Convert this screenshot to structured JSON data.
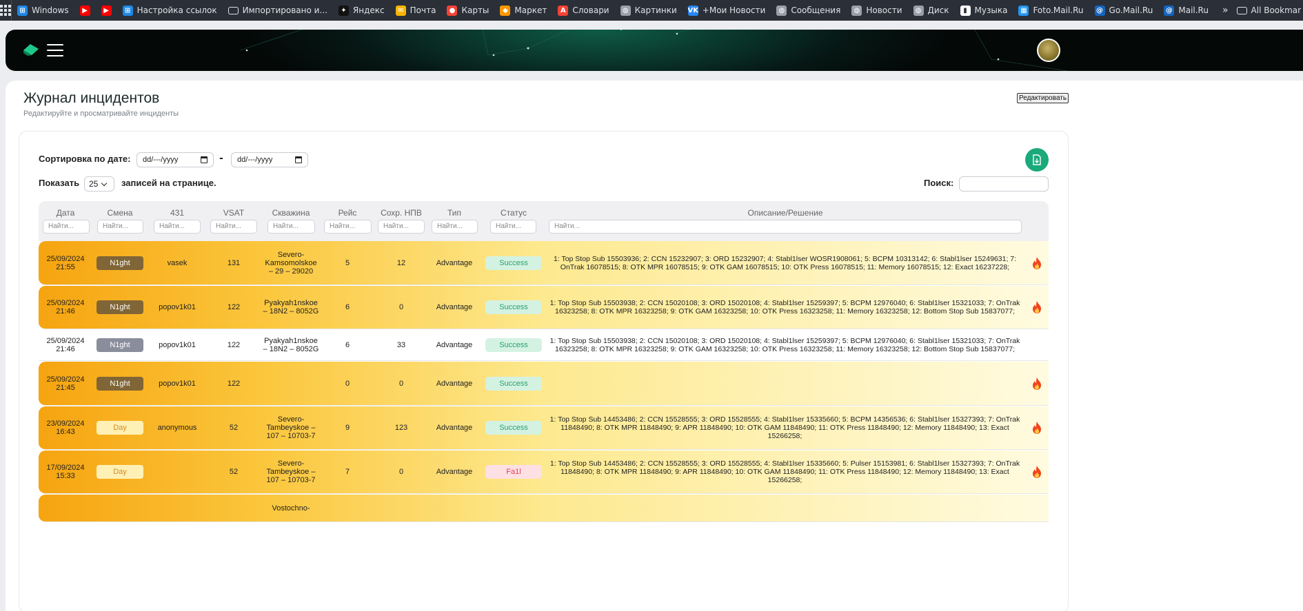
{
  "bookmarks": [
    {
      "label": "Windows",
      "icon": "windows-icon",
      "color": "#1e88e5"
    },
    {
      "label": "",
      "icon": "youtube-icon",
      "color": "#ff0000"
    },
    {
      "label": "",
      "icon": "youtube-icon",
      "color": "#ff0000"
    },
    {
      "label": "Настройка ссылок",
      "icon": "windows-icon",
      "color": "#1e88e5"
    },
    {
      "label": "Импортировано и...",
      "icon": "folder-icon",
      "color": "#2b2f38"
    },
    {
      "label": "Яндекс",
      "icon": "yandex-icon",
      "color": "#111111"
    },
    {
      "label": "Почта",
      "icon": "mail-icon",
      "color": "#f7b500"
    },
    {
      "label": "Карты",
      "icon": "map-pin-icon",
      "color": "#f44336"
    },
    {
      "label": "Маркет",
      "icon": "market-icon",
      "color": "#ff9800"
    },
    {
      "label": "Словари",
      "icon": "dictionary-icon",
      "color": "#f44336"
    },
    {
      "label": "Картинки",
      "icon": "globe-icon",
      "color": "#9aa0aa"
    },
    {
      "label": "+Мои Новости",
      "icon": "vk-icon",
      "color": "#2787f5"
    },
    {
      "label": "Сообщения",
      "icon": "globe-icon",
      "color": "#9aa0aa"
    },
    {
      "label": "Новости",
      "icon": "globe-icon",
      "color": "#9aa0aa"
    },
    {
      "label": "Диск",
      "icon": "globe-icon",
      "color": "#9aa0aa"
    },
    {
      "label": "Музыка",
      "icon": "music-icon",
      "color": "#ffffff"
    },
    {
      "label": "Foto.Mail.Ru",
      "icon": "photo-icon",
      "color": "#2196f3"
    },
    {
      "label": "Go.Mail.Ru",
      "icon": "mailru-icon",
      "color": "#1565c0"
    },
    {
      "label": "Mail.Ru",
      "icon": "mailru-icon",
      "color": "#1565c0"
    }
  ],
  "bookmarks_more": "»",
  "all_bookmarks": "All Bookmar",
  "page": {
    "title": "Журнал инцидентов",
    "subtitle": "Редактируйте и просматривайте инциденты",
    "edit_button": "Редактировать"
  },
  "controls": {
    "sort_label": "Сортировка по дате:",
    "date_from_placeholder": "dd/---/yyyy",
    "date_to_placeholder": "dd/---/yyyy",
    "date_separator": "-",
    "show_label": "Показать",
    "page_size": "25",
    "records_label": "записей на странице.",
    "search_label": "Поиск:"
  },
  "columns": [
    {
      "label": "Дата",
      "filter": "Найти..."
    },
    {
      "label": "Смена",
      "filter": "Найти..."
    },
    {
      "label": "431",
      "filter": "Найти..."
    },
    {
      "label": "VSAT",
      "filter": "Найти..."
    },
    {
      "label": "Скважина",
      "filter": "Найти..."
    },
    {
      "label": "Рейс",
      "filter": "Найти..."
    },
    {
      "label": "Сохр. НПВ",
      "filter": "Найти..."
    },
    {
      "label": "Тип",
      "filter": "Найти..."
    },
    {
      "label": "Статус",
      "filter": "Найти..."
    },
    {
      "label": "Описание/Решение",
      "filter": "Найти..."
    }
  ],
  "rows": [
    {
      "date": "25/09/2024",
      "time": "21:55",
      "shift": "N1ght",
      "shift_style": "night",
      "user": "vasek",
      "vsat": "131",
      "well": "Severo-\nKamsomolskoe\n– 29 – 29020",
      "trip": "5",
      "npv": "12",
      "type": "Advantage",
      "status": "Success",
      "status_style": "ok",
      "desc": "1: Top Stop Sub 15503936; 2: CCN 15232907; 3: ORD 15232907; 4: Stabl1lser WOSR1908061; 5: BCPM 10313142; 6: Stabl1lser 15249631; 7: OnTrak 16078515; 8: OTK MPR 16078515; 9: OTK GAM 16078515; 10: OTK Press 16078515; 11: Memory 16078515; 12: Exact 16237228;",
      "hot": true
    },
    {
      "date": "25/09/2024",
      "time": "21:46",
      "shift": "N1ght",
      "shift_style": "night",
      "user": "popov1k01",
      "vsat": "122",
      "well": "Pyakyah1nskoe\n– 18N2 – 8052G",
      "trip": "6",
      "npv": "0",
      "type": "Advantage",
      "status": "Success",
      "status_style": "ok",
      "desc": "1: Top Stop Sub 15503938; 2: CCN 15020108; 3: ORD 15020108; 4: Stabl1lser 15259397; 5: BCPM 12976040; 6: Stabl1lser 15321033; 7: OnTrak 16323258; 8: OTK MPR 16323258; 9: OTK GAM 16323258; 10: OTK Press 16323258; 11: Memory 16323258; 12: Bottom Stop Sub 15837077;",
      "hot": true
    },
    {
      "date": "25/09/2024",
      "time": "21:46",
      "shift": "N1ght",
      "shift_style": "night-grey",
      "user": "popov1k01",
      "vsat": "122",
      "well": "Pyakyah1nskoe\n– 18N2 – 8052G",
      "trip": "6",
      "npv": "33",
      "type": "Advantage",
      "status": "Success",
      "status_style": "ok",
      "desc": "1: Top Stop Sub 15503938; 2: CCN 15020108; 3: ORD 15020108; 4: Stabl1lser 15259397; 5: BCPM 12976040; 6: Stabl1lser 15321033; 7: OnTrak 16323258; 8: OTK MPR 16323258; 9: OTK GAM 16323258; 10: OTK Press 16323258; 11: Memory 16323258; 12: Bottom Stop Sub 15837077;",
      "hot": false
    },
    {
      "date": "25/09/2024",
      "time": "21:45",
      "shift": "N1ght",
      "shift_style": "night",
      "user": "popov1k01",
      "vsat": "122",
      "well": "",
      "trip": "0",
      "npv": "0",
      "type": "Advantage",
      "status": "Success",
      "status_style": "ok",
      "desc": "",
      "hot": true
    },
    {
      "date": "23/09/2024",
      "time": "16:43",
      "shift": "Day",
      "shift_style": "day",
      "user": "anonymous",
      "vsat": "52",
      "well": "Severo-\nTambeyskoe –\n107 – 10703-7",
      "trip": "9",
      "npv": "123",
      "type": "Advantage",
      "status": "Success",
      "status_style": "ok",
      "desc": "1: Top Stop Sub 14453486; 2: CCN 15528555; 3: ORD 15528555; 4: Stabl1lser 15335660; 5: BCPM 14356536; 6: Stabl1lser 15327393; 7: OnTrak 11848490; 8: OTK MPR 11848490; 9: APR 11848490; 10: OTK GAM 11848490; 11: OTK Press 11848490; 12: Memory 11848490; 13: Exact 15266258;",
      "hot": true
    },
    {
      "date": "17/09/2024",
      "time": "15:33",
      "shift": "Day",
      "shift_style": "day",
      "user": "",
      "vsat": "52",
      "well": "Severo-\nTambeyskoe –\n107 – 10703-7",
      "trip": "7",
      "npv": "0",
      "type": "Advantage",
      "status": "Fa1l",
      "status_style": "fail",
      "desc": "1: Top Stop Sub 14453486; 2: CCN 15528555; 3: ORD 15528555; 4: Stabl1lser 15335660; 5: Pulser 15153981; 6: Stabl1lser 15327393; 7: OnTrak 11848490; 8: OTK MPR 11848490; 9: APR 11848490; 10: OTK GAM 11848490; 11: OTK Press 11848490; 12: Memory 11848490; 13: Exact 15266258;",
      "hot": true
    },
    {
      "date": "",
      "time": "",
      "shift": "",
      "shift_style": "",
      "user": "",
      "vsat": "",
      "well": "Vostochno-",
      "trip": "",
      "npv": "",
      "type": "",
      "status": "",
      "status_style": "",
      "desc": "",
      "hot": true
    }
  ],
  "colors": {
    "accent": "#1aa97a",
    "night": "#806536",
    "day_bg": "#fff0b6",
    "success_bg": "#d4f2e2",
    "fail_bg": "#fde0e4",
    "hot_from": "#f6a410",
    "hot_to": "#fffbe0"
  }
}
